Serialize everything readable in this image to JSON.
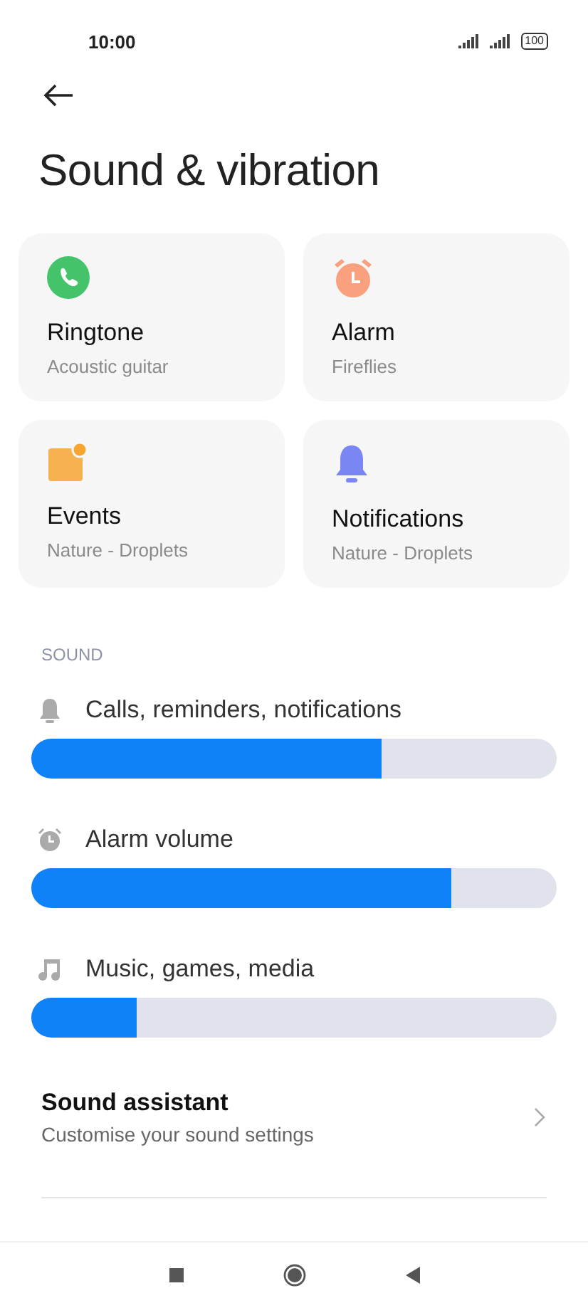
{
  "status_bar": {
    "time": "10:00",
    "battery": "100"
  },
  "title": "Sound & vibration",
  "cards": [
    {
      "kind": "phone",
      "title": "Ringtone",
      "subtitle": "Acoustic guitar"
    },
    {
      "kind": "alarm",
      "title": "Alarm",
      "subtitle": "Fireflies"
    },
    {
      "kind": "events",
      "title": "Events",
      "subtitle": "Nature - Droplets"
    },
    {
      "kind": "bell",
      "title": "Notifications",
      "subtitle": "Nature - Droplets"
    }
  ],
  "section": "SOUND",
  "sliders": [
    {
      "kind": "bell",
      "label": "Calls, reminders, notifications",
      "level": 0.667
    },
    {
      "kind": "alarm",
      "label": "Alarm volume",
      "level": 0.8
    },
    {
      "kind": "music",
      "label": "Music, games, media",
      "level": 0.2
    }
  ],
  "assistant": {
    "title": "Sound assistant",
    "subtitle": "Customise your sound settings"
  }
}
